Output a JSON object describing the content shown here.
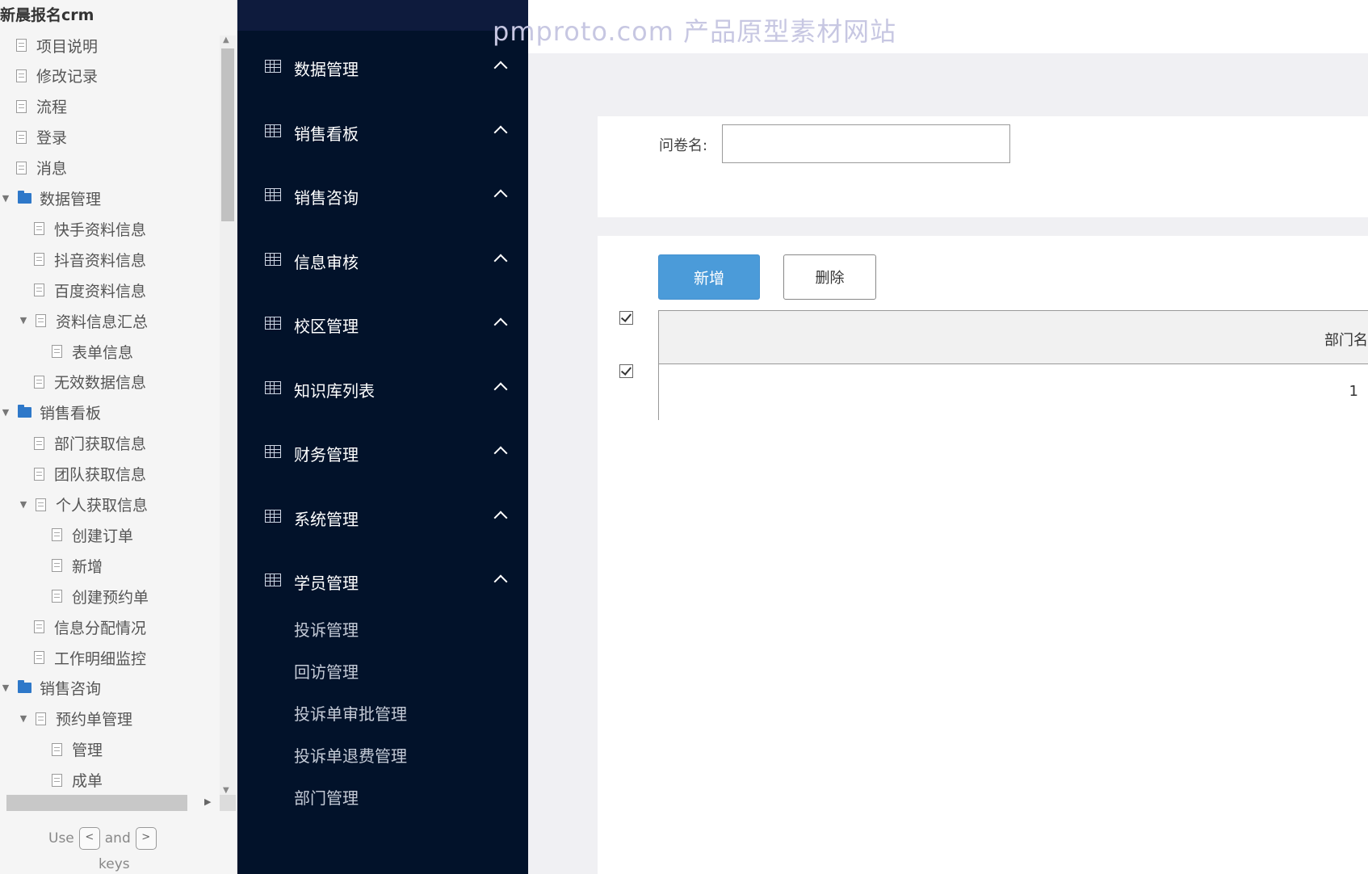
{
  "outline": {
    "title": "新晨报名crm",
    "items": [
      {
        "label": "项目说明",
        "type": "page",
        "level": 0,
        "arrow": ""
      },
      {
        "label": "修改记录",
        "type": "page",
        "level": 0,
        "arrow": ""
      },
      {
        "label": "流程",
        "type": "page",
        "level": 0,
        "arrow": ""
      },
      {
        "label": "登录",
        "type": "page",
        "level": 0,
        "arrow": ""
      },
      {
        "label": "消息",
        "type": "page",
        "level": 0,
        "arrow": ""
      },
      {
        "label": "数据管理",
        "type": "folder",
        "level": 0,
        "arrow": "▼"
      },
      {
        "label": "快手资料信息",
        "type": "page",
        "level": 1,
        "arrow": ""
      },
      {
        "label": "抖音资料信息",
        "type": "page",
        "level": 1,
        "arrow": ""
      },
      {
        "label": "百度资料信息",
        "type": "page",
        "level": 1,
        "arrow": ""
      },
      {
        "label": "资料信息汇总",
        "type": "page",
        "level": 1,
        "arrow": "▼"
      },
      {
        "label": "表单信息",
        "type": "page",
        "level": 2,
        "arrow": ""
      },
      {
        "label": "无效数据信息",
        "type": "page",
        "level": 1,
        "arrow": ""
      },
      {
        "label": "销售看板",
        "type": "folder",
        "level": 0,
        "arrow": "▼"
      },
      {
        "label": "部门获取信息",
        "type": "page",
        "level": 1,
        "arrow": ""
      },
      {
        "label": "团队获取信息",
        "type": "page",
        "level": 1,
        "arrow": ""
      },
      {
        "label": "个人获取信息",
        "type": "page",
        "level": 1,
        "arrow": "▼"
      },
      {
        "label": "创建订单",
        "type": "page",
        "level": 2,
        "arrow": ""
      },
      {
        "label": "新增",
        "type": "page",
        "level": 2,
        "arrow": ""
      },
      {
        "label": "创建预约单",
        "type": "page",
        "level": 2,
        "arrow": ""
      },
      {
        "label": "信息分配情况",
        "type": "page",
        "level": 1,
        "arrow": ""
      },
      {
        "label": "工作明细监控",
        "type": "page",
        "level": 1,
        "arrow": ""
      },
      {
        "label": "销售咨询",
        "type": "folder",
        "level": 0,
        "arrow": "▼"
      },
      {
        "label": "预约单管理",
        "type": "page",
        "level": 1,
        "arrow": "▼"
      },
      {
        "label": "管理",
        "type": "page",
        "level": 2,
        "arrow": ""
      },
      {
        "label": "成单",
        "type": "page",
        "level": 2,
        "arrow": ""
      }
    ],
    "hint": {
      "use": "Use",
      "and": "and",
      "keys": "keys",
      "key_left": "<",
      "key_right": ">"
    }
  },
  "watermark": "pmproto.com 产品原型素材网站",
  "nav": {
    "groups": [
      {
        "label": "数据管理"
      },
      {
        "label": "销售看板"
      },
      {
        "label": "销售咨询"
      },
      {
        "label": "信息审核"
      },
      {
        "label": "校区管理"
      },
      {
        "label": "知识库列表"
      },
      {
        "label": "财务管理"
      },
      {
        "label": "系统管理"
      },
      {
        "label": "学员管理"
      }
    ],
    "subitems": [
      {
        "label": "投诉管理"
      },
      {
        "label": "回访管理"
      },
      {
        "label": "投诉单审批管理"
      },
      {
        "label": "投诉单退费管理"
      },
      {
        "label": "部门管理"
      }
    ]
  },
  "form": {
    "label": "问卷名:",
    "value": "",
    "placeholder": ""
  },
  "toolbar": {
    "add_label": "新增",
    "delete_label": "删除"
  },
  "table": {
    "header": "部门名",
    "rows": [
      {
        "value": "1"
      }
    ]
  },
  "colors": {
    "nav_bg": "#02122a",
    "primary": "#4b9bd9",
    "outline_folder": "#2e78c9"
  }
}
